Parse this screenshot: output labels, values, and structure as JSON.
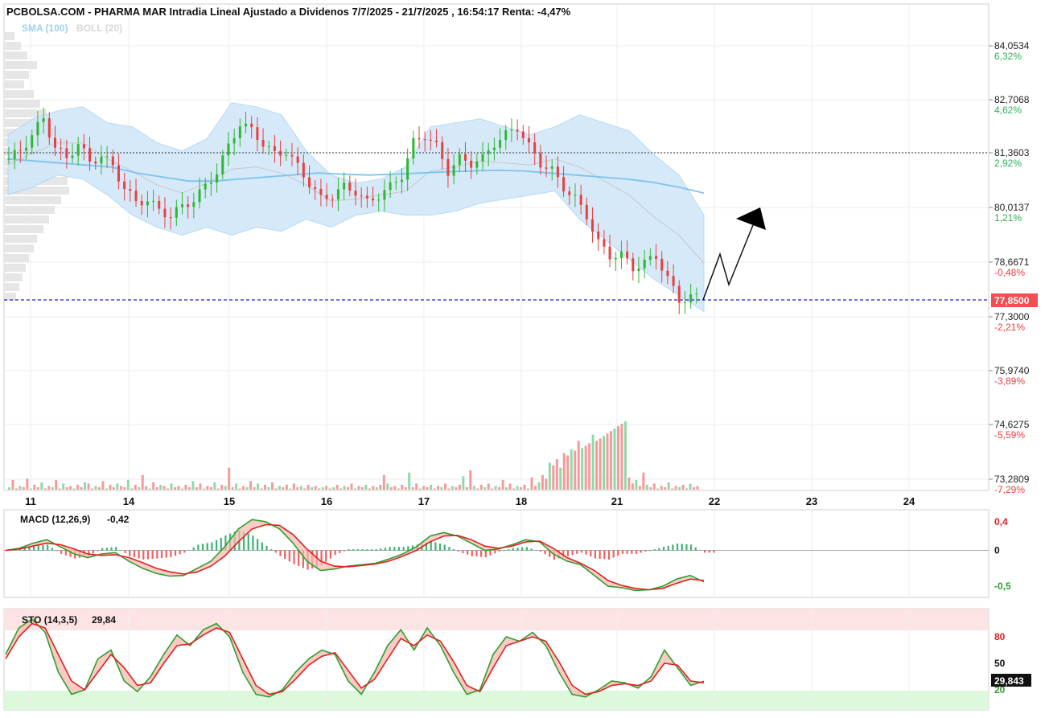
{
  "header": {
    "title": "PCBOLSA.COM - PHARMA MAR Intradia Lineal Ajustado a Dividenos 7/7/2025 - 21/7/2025 , 16:54:17 Renta: -4,47%",
    "legend_sma": "SMA (100)",
    "legend_boll": "BOLL (20)"
  },
  "colors": {
    "up": "#2eb82e",
    "down": "#e84040",
    "band_fill": "#cfe6f8",
    "sma": "#7fc3ee",
    "current_line": "#2222cc",
    "current_label_bg": "#f05050",
    "sto_over_bg": "#fde4e4",
    "sto_under_bg": "#ddf8dd"
  },
  "chart_data": [
    {
      "type": "line",
      "name": "price",
      "ylim": [
        73.2809,
        85.0
      ],
      "y_ticks": [
        {
          "value": "84,0534",
          "pct": "6,32%"
        },
        {
          "value": "82,7068",
          "pct": "4,62%"
        },
        {
          "value": "81,3603",
          "pct": "2,92%"
        },
        {
          "value": "80,0137",
          "pct": "1,21%"
        },
        {
          "value": "78,6671",
          "pct": "-0,48%"
        },
        {
          "value": "77,3000",
          "pct": "-2,21%"
        },
        {
          "value": "75,9740",
          "pct": "-3,89%"
        },
        {
          "value": "74,6275",
          "pct": "-5,59%"
        },
        {
          "value": "73,2809",
          "pct": "-7,29%"
        }
      ],
      "x_ticks": [
        "11",
        "14",
        "15",
        "16",
        "17",
        "18",
        "21",
        "22",
        "23",
        "24"
      ],
      "current_price": "77,8500",
      "reference_line": 81.36,
      "closes": [
        81.3,
        81.5,
        81.9,
        82.3,
        81.6,
        81.3,
        81.7,
        81.2,
        81.4,
        81.1,
        80.6,
        80.2,
        80.3,
        80.0,
        79.9,
        80.1,
        80.3,
        80.6,
        81.0,
        81.6,
        82.2,
        82.0,
        81.7,
        81.4,
        81.5,
        81.1,
        80.7,
        80.3,
        80.4,
        80.6,
        80.5,
        80.2,
        80.4,
        80.6,
        80.9,
        81.7,
        81.9,
        81.6,
        81.0,
        81.3,
        81.2,
        81.3,
        81.7,
        81.9,
        82.1,
        81.6,
        81.2,
        81.0,
        80.6,
        80.3,
        79.9,
        79.2,
        78.9,
        78.9,
        78.6,
        78.7,
        78.9,
        78.3,
        77.8,
        77.85
      ],
      "sma": [
        81.3,
        81.25,
        81.2,
        81.15,
        81.1,
        80.95,
        80.85,
        80.75,
        80.75,
        80.8,
        80.85,
        80.9,
        80.95,
        80.92,
        80.9,
        80.92,
        80.95,
        80.98,
        81.0,
        81.02,
        81.0,
        80.95,
        80.9,
        80.85,
        80.8,
        80.72,
        80.6,
        80.45
      ],
      "boll_upper": [
        81.9,
        82.3,
        82.5,
        82.6,
        82.2,
        82.1,
        81.7,
        81.5,
        81.8,
        82.7,
        82.6,
        82.4,
        81.5,
        80.9,
        80.7,
        80.8,
        81.1,
        82.1,
        82.2,
        82.3,
        82.1,
        81.9,
        82.1,
        82.4,
        82.2,
        82.0,
        81.4,
        80.9,
        79.9
      ],
      "boll_lower": [
        80.4,
        80.6,
        80.9,
        80.8,
        80.4,
        79.9,
        79.6,
        79.4,
        79.6,
        79.4,
        79.6,
        79.5,
        79.8,
        79.6,
        79.9,
        80.0,
        79.9,
        79.9,
        80.0,
        80.2,
        80.3,
        80.4,
        80.5,
        79.8,
        79.3,
        78.8,
        78.3,
        77.9,
        77.5
      ],
      "volumes": [
        2,
        8,
        1,
        3,
        2,
        9,
        1,
        4,
        2,
        6,
        1,
        3,
        2,
        8,
        1,
        5,
        2,
        3,
        1,
        4,
        2,
        6,
        5,
        1,
        3,
        2,
        7,
        1,
        4,
        2,
        5,
        3,
        2,
        8,
        1,
        4,
        2,
        12,
        3,
        1,
        6,
        2,
        4,
        3,
        1,
        5,
        2,
        3,
        1,
        4,
        2,
        7,
        2,
        5,
        1,
        3,
        2,
        6,
        1,
        4,
        3,
        18,
        2,
        5,
        1,
        3,
        2,
        7,
        2,
        5,
        1,
        4,
        2,
        6,
        1,
        3,
        2,
        4,
        1,
        5,
        2,
        3,
        1,
        4,
        2,
        3,
        1,
        2,
        3,
        1,
        2,
        4,
        1,
        3,
        2,
        5,
        1,
        3,
        2,
        4,
        1,
        3,
        2,
        4,
        12,
        5,
        2,
        3,
        1,
        4,
        2,
        14,
        2,
        5,
        1,
        3,
        2,
        4,
        1,
        3,
        2,
        5,
        1,
        3,
        2,
        4,
        11,
        2,
        16,
        3,
        1,
        4,
        2,
        5,
        1,
        3,
        2,
        8,
        2,
        5,
        1,
        3,
        2,
        4,
        1,
        10,
        3,
        6,
        12,
        9,
        22,
        20,
        25,
        18,
        30,
        28,
        33,
        32,
        40,
        34,
        36,
        38,
        45,
        40,
        42,
        44,
        46,
        48,
        50,
        52,
        54,
        56,
        10,
        5,
        8,
        3,
        14,
        4,
        2,
        5,
        1,
        3,
        2,
        6,
        1,
        3,
        2,
        4,
        1,
        5,
        2,
        3
      ]
    },
    {
      "type": "line",
      "name": "MACD",
      "label": "MACD (12,26,9)",
      "value": "-0,42",
      "ylim": [
        -0.6,
        0.5
      ],
      "y_ticks": [
        "0,4",
        "0",
        "-0,5"
      ],
      "macd": [
        0.0,
        0.03,
        0.1,
        0.15,
        0.05,
        -0.05,
        -0.1,
        -0.05,
        -0.03,
        -0.15,
        -0.25,
        -0.32,
        -0.36,
        -0.35,
        -0.25,
        -0.15,
        0.05,
        0.3,
        0.43,
        0.4,
        0.3,
        0.1,
        -0.15,
        -0.28,
        -0.26,
        -0.22,
        -0.2,
        -0.18,
        -0.12,
        -0.05,
        0.05,
        0.2,
        0.25,
        0.2,
        0.1,
        0.0,
        0.02,
        0.08,
        0.15,
        0.12,
        -0.05,
        -0.15,
        -0.2,
        -0.35,
        -0.5,
        -0.52,
        -0.56,
        -0.55,
        -0.5,
        -0.4,
        -0.35,
        -0.44
      ],
      "signal": [
        0.0,
        0.02,
        0.06,
        0.1,
        0.08,
        0.02,
        -0.05,
        -0.07,
        -0.06,
        -0.1,
        -0.17,
        -0.25,
        -0.3,
        -0.33,
        -0.3,
        -0.22,
        -0.08,
        0.12,
        0.3,
        0.36,
        0.35,
        0.22,
        0.02,
        -0.15,
        -0.22,
        -0.23,
        -0.21,
        -0.19,
        -0.15,
        -0.08,
        0.0,
        0.12,
        0.2,
        0.21,
        0.15,
        0.06,
        0.03,
        0.06,
        0.12,
        0.13,
        0.03,
        -0.1,
        -0.18,
        -0.28,
        -0.42,
        -0.49,
        -0.53,
        -0.55,
        -0.53,
        -0.46,
        -0.4,
        -0.42
      ]
    },
    {
      "type": "line",
      "name": "STO",
      "label": "STO (14,3,5)",
      "value": "29,84",
      "current_value": "29,843",
      "ylim": [
        0,
        100
      ],
      "y_ticks": [
        "80",
        "50",
        "20"
      ],
      "k": [
        60,
        90,
        100,
        85,
        40,
        15,
        20,
        55,
        65,
        30,
        18,
        35,
        60,
        82,
        70,
        88,
        95,
        80,
        40,
        15,
        12,
        20,
        40,
        55,
        65,
        60,
        30,
        15,
        40,
        70,
        88,
        65,
        90,
        70,
        40,
        15,
        20,
        60,
        80,
        75,
        85,
        70,
        40,
        15,
        12,
        20,
        30,
        28,
        22,
        35,
        65,
        45,
        25,
        29.84
      ],
      "d": [
        55,
        80,
        95,
        90,
        60,
        30,
        20,
        40,
        60,
        45,
        25,
        28,
        50,
        70,
        72,
        82,
        90,
        85,
        55,
        25,
        15,
        18,
        32,
        48,
        58,
        62,
        42,
        22,
        32,
        55,
        78,
        70,
        82,
        75,
        52,
        25,
        18,
        45,
        70,
        75,
        80,
        75,
        52,
        25,
        15,
        18,
        25,
        27,
        25,
        30,
        50,
        48,
        30,
        28
      ]
    }
  ]
}
